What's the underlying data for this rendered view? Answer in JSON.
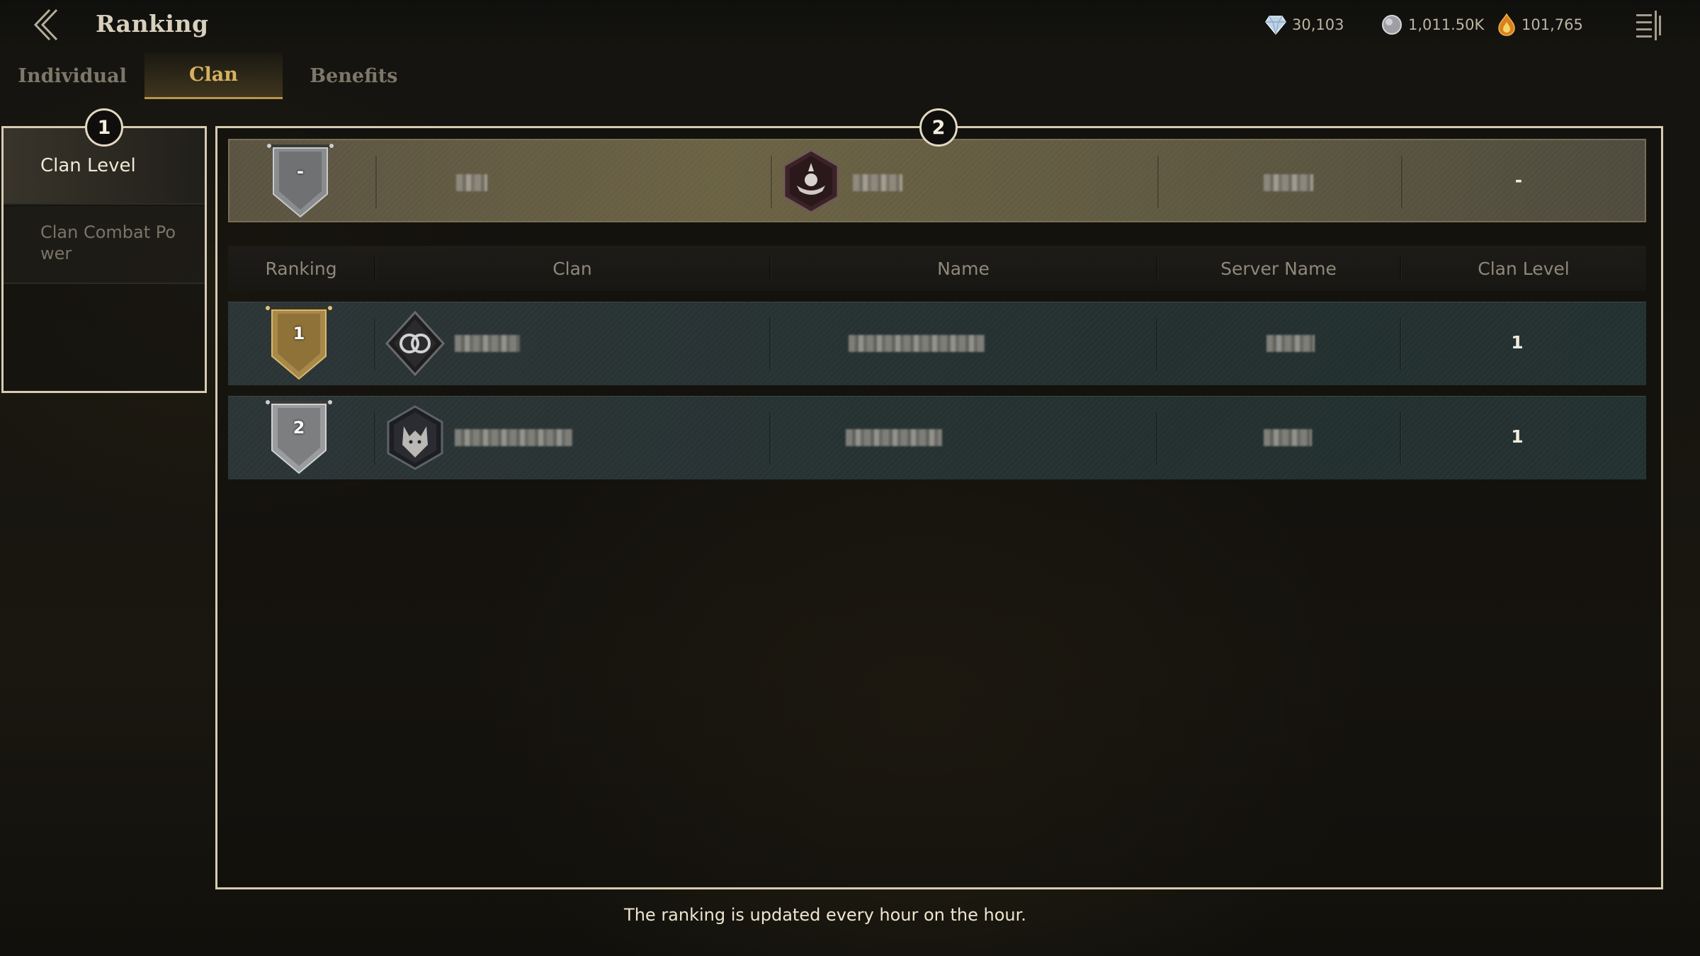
{
  "header": {
    "title": "Ranking"
  },
  "currencies": [
    {
      "icon": "diamond-icon",
      "value": "30,103"
    },
    {
      "icon": "silver-orb-icon",
      "value": "1,011.50K"
    },
    {
      "icon": "flame-gem-icon",
      "value": "101,765"
    }
  ],
  "tabs": [
    {
      "label": "Individual"
    },
    {
      "label": "Clan"
    },
    {
      "label": "Benefits"
    }
  ],
  "active_tab": "Clan",
  "sidebar": {
    "items": [
      {
        "label": "Clan Level"
      },
      {
        "label": "Clan Combat Power"
      }
    ]
  },
  "markers": [
    "1",
    "2"
  ],
  "table": {
    "columns": [
      "Ranking",
      "Clan",
      "Name",
      "Server Name",
      "Clan Level"
    ],
    "my_clan": {
      "rank": "-",
      "clan_level": "-"
    },
    "rows": [
      {
        "rank": "1",
        "clan_level": "1"
      },
      {
        "rank": "2",
        "clan_level": "1"
      }
    ]
  },
  "footer": {
    "note": "The ranking is updated every hour on the hour."
  },
  "colors": {
    "accent_gold": "#d7b161",
    "panel_border": "#d6ccb2",
    "my_row": "#6b6244",
    "rank_row": "#273233"
  }
}
